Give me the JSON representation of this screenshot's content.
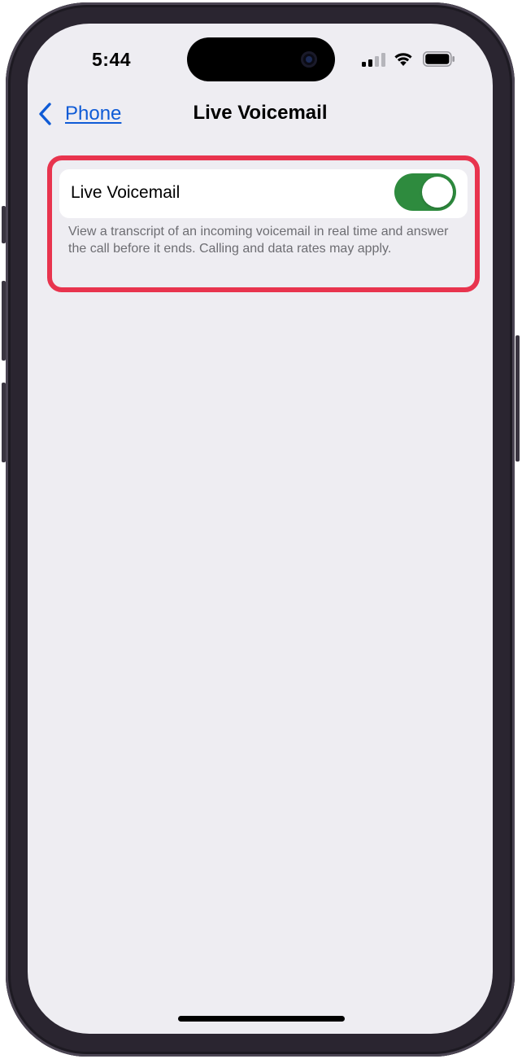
{
  "status_bar": {
    "time": "5:44",
    "icons": [
      "signal-icon",
      "wifi-icon",
      "battery-icon"
    ]
  },
  "nav": {
    "back_label": "Phone",
    "title": "Live Voicemail",
    "back_icon": "chevron-left-icon"
  },
  "settings": {
    "live_voicemail_label": "Live Voicemail",
    "live_voicemail_enabled": true,
    "footer": "View a transcript of an incoming voicemail in real time and answer the call before it ends. Calling and data rates may apply."
  },
  "colors": {
    "accent": "#0f5bd6",
    "toggle_on": "#2e8b3e",
    "highlight": "#e8344e",
    "background": "#eeedf2"
  }
}
